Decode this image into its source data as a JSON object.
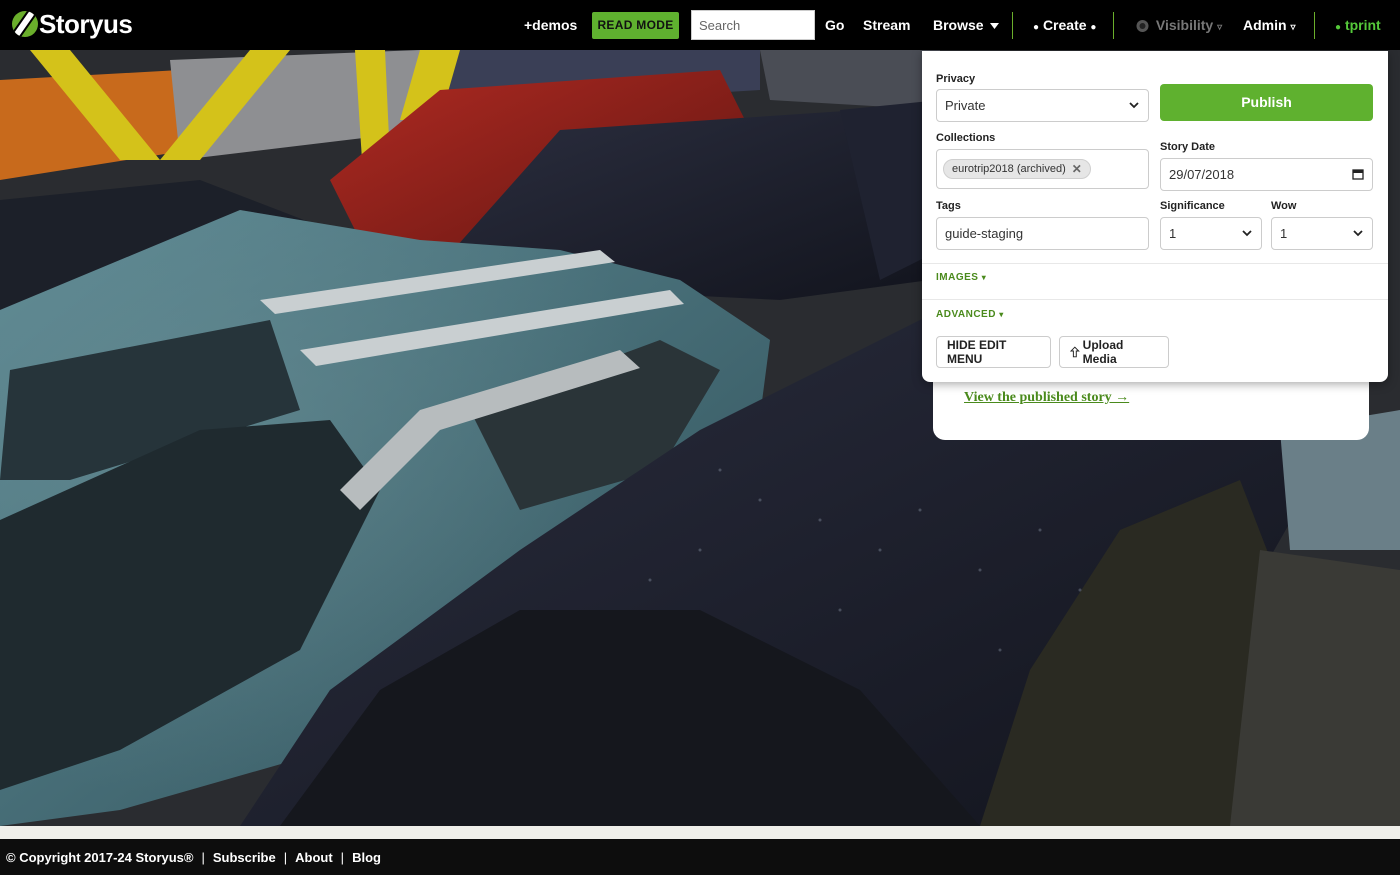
{
  "brand": {
    "name": "Storyus",
    "accent": "#5fb12f"
  },
  "nav": {
    "demos": "+demos",
    "read_mode": "READ MODE",
    "search_placeholder": "Search",
    "go": "Go",
    "stream": "Stream",
    "browse": "Browse",
    "browse_icon": "caret-down-icon",
    "create": "Create",
    "visibility": "Visibility",
    "visibility_icon": "eye-icon",
    "admin": "Admin",
    "user": "tprint"
  },
  "edit_panel": {
    "privacy_label": "Privacy",
    "privacy_value": "Private",
    "publish_label": "Publish",
    "collections_label": "Collections",
    "collection_chip": "eurotrip2018 (archived)",
    "story_date_label": "Story Date",
    "story_date_value": "29/07/2018",
    "tags_label": "Tags",
    "tags_value": "guide-staging",
    "significance_label": "Significance",
    "significance_value": "1",
    "wow_label": "Wow",
    "wow_value": "1",
    "images_section": "IMAGES",
    "advanced_section": "ADVANCED",
    "hide_edit_menu": "HIDE EDIT MENU",
    "upload_media": "Upload Media"
  },
  "story_card": {
    "view_link": "View the published story →"
  },
  "footer": {
    "copyright": "© Copyright 2017-24 Storyus®",
    "subscribe": "Subscribe",
    "about": "About",
    "blog": "Blog"
  }
}
